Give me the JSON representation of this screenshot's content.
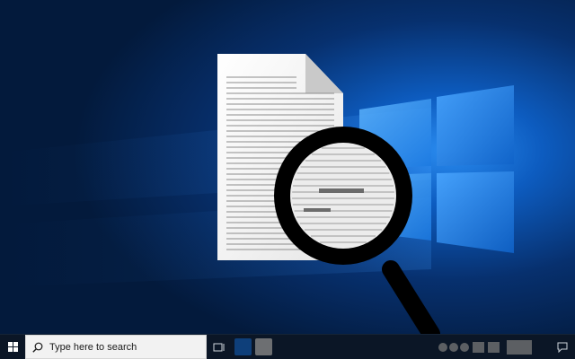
{
  "taskbar": {
    "search": {
      "placeholder": "Type here to search"
    },
    "start_icon": "windows-logo-icon",
    "search_icon": "magnifier-icon",
    "task_view_icon": "task-view-icon",
    "notification_icon": "action-center-icon",
    "pinned_apps": [
      "app-tile-blue",
      "app-tile-gray"
    ]
  },
  "wallpaper": {
    "theme": "windows-10-hero",
    "accent": "#1a7fe0",
    "background": "#031a3c"
  },
  "illustration": {
    "document_icon": "text-document-icon",
    "magnifier_icon": "magnifying-glass-icon"
  }
}
